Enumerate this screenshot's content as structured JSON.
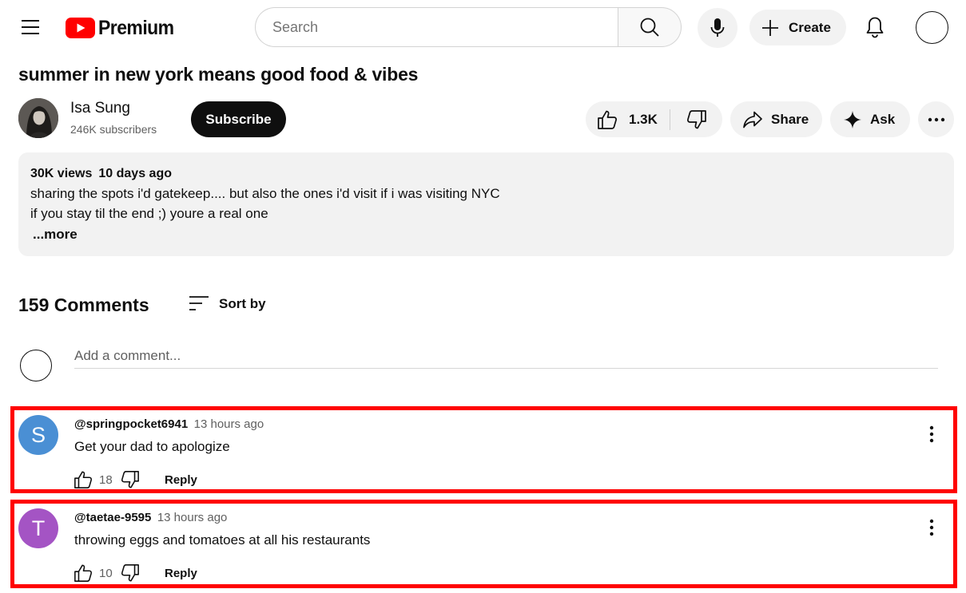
{
  "header": {
    "logo_text": "Premium",
    "search_placeholder": "Search",
    "create_label": "Create",
    "brand_color": "#ff0000"
  },
  "video": {
    "title": "summer in new york means good food & vibes",
    "channel_name": "Isa Sung",
    "subscribers": "246K subscribers",
    "subscribe_label": "Subscribe",
    "like_count": "1.3K",
    "share_label": "Share",
    "ask_label": "Ask"
  },
  "description": {
    "views": "30K views",
    "date": "10 days ago",
    "line1": "sharing the spots i'd gatekeep.... but also the ones i'd visit if i was visiting NYC",
    "line2": "if you stay til the end ;) youre a real one",
    "more_label": "...more"
  },
  "comments_section": {
    "count_label": "159 Comments",
    "sort_label": "Sort by",
    "add_placeholder": "Add a comment...",
    "highlight_color": "#ff0000",
    "comments": [
      {
        "avatar_letter": "S",
        "avatar_color": "#4a8fd4",
        "author": "@springpocket6941",
        "time": "13 hours ago",
        "text": "Get your dad to apologize",
        "likes": "18",
        "reply_label": "Reply"
      },
      {
        "avatar_letter": "T",
        "avatar_color": "#a454c4",
        "author": "@taetae-9595",
        "time": "13 hours ago",
        "text": "throwing eggs and tomatoes at all his restaurants",
        "likes": "10",
        "reply_label": "Reply"
      }
    ]
  }
}
